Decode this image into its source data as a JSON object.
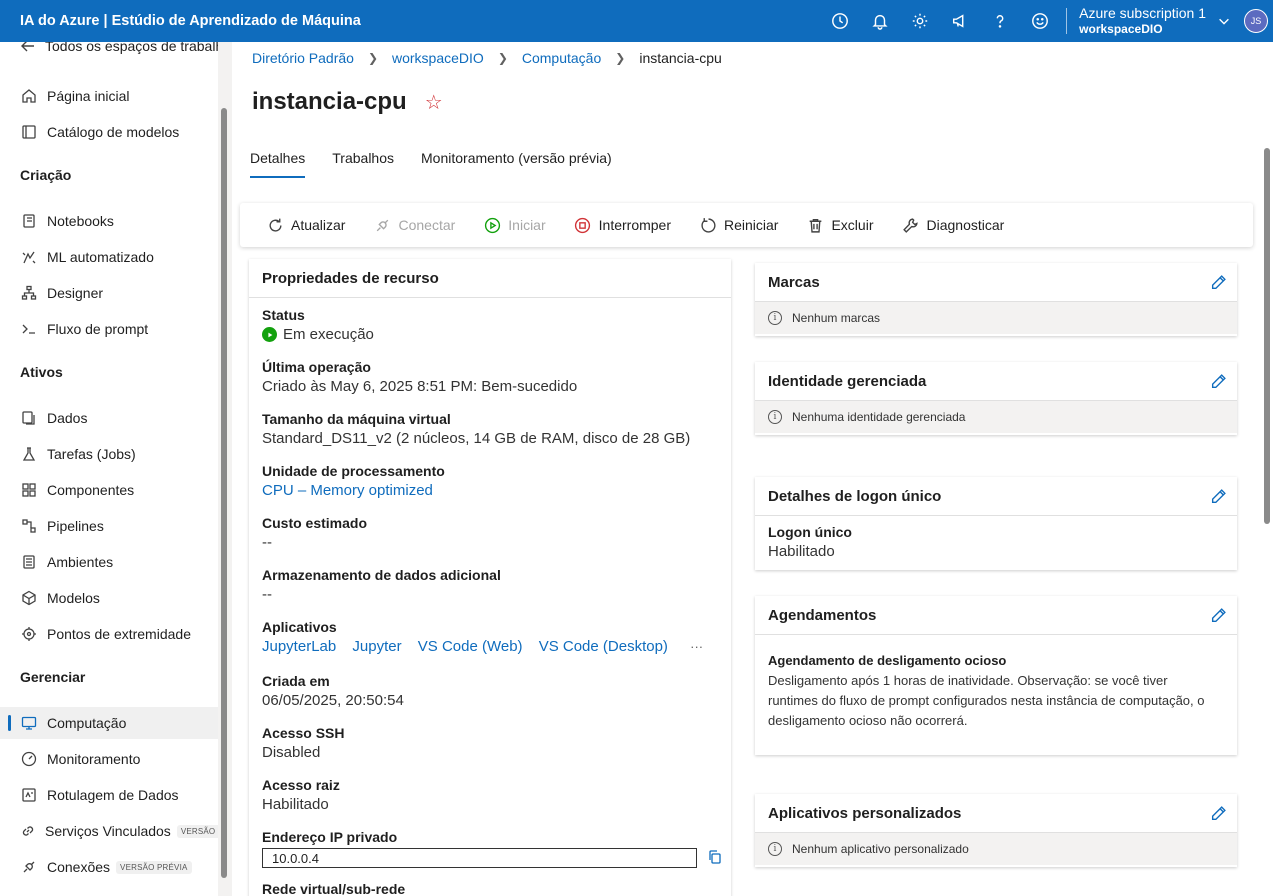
{
  "app": {
    "title": "IA do Azure | Estúdio de Aprendizado de Máquina",
    "subscription": "Azure subscription 1",
    "workspace": "workspaceDIO",
    "avatar": "JS",
    "header_icons": [
      "clock-icon",
      "bell-icon",
      "gear-icon",
      "megaphone-icon",
      "help-icon",
      "smiley-icon"
    ]
  },
  "sidebar": {
    "back_label": "Todos os espaços de trabalho",
    "items_top": [
      {
        "label": "Página inicial",
        "icon": "home-icon"
      },
      {
        "label": "Catálogo de modelos",
        "icon": "catalog-icon"
      }
    ],
    "section_criacao": "Criação",
    "items_criacao": [
      {
        "label": "Notebooks",
        "icon": "notebook-icon"
      },
      {
        "label": "ML automatizado",
        "icon": "automl-icon"
      },
      {
        "label": "Designer",
        "icon": "designer-icon"
      },
      {
        "label": "Fluxo de prompt",
        "icon": "prompt-icon"
      }
    ],
    "section_ativos": "Ativos",
    "items_ativos": [
      {
        "label": "Dados",
        "icon": "data-icon"
      },
      {
        "label": "Tarefas (Jobs)",
        "icon": "flask-icon"
      },
      {
        "label": "Componentes",
        "icon": "components-icon"
      },
      {
        "label": "Pipelines",
        "icon": "pipelines-icon"
      },
      {
        "label": "Ambientes",
        "icon": "environments-icon"
      },
      {
        "label": "Modelos",
        "icon": "cube-icon"
      },
      {
        "label": "Pontos de extremidade",
        "icon": "endpoints-icon"
      }
    ],
    "section_gerenciar": "Gerenciar",
    "items_gerenciar": [
      {
        "label": "Computação",
        "icon": "monitor-icon",
        "active": true
      },
      {
        "label": "Monitoramento",
        "icon": "gauge-icon"
      },
      {
        "label": "Rotulagem de Dados",
        "icon": "label-icon"
      },
      {
        "label": "Serviços Vinculados",
        "icon": "link-icon",
        "badge": "VERSÃO PRÉVIA"
      },
      {
        "label": "Conexões",
        "icon": "plug-icon",
        "badge": "VERSÃO PRÉVIA"
      }
    ]
  },
  "breadcrumb": [
    "Diretório Padrão",
    "workspaceDIO",
    "Computação",
    "instancia-cpu"
  ],
  "page": {
    "title": "instancia-cpu",
    "tabs": [
      "Detalhes",
      "Trabalhos",
      "Monitoramento (versão prévia)"
    ]
  },
  "toolbar": {
    "atualizar": "Atualizar",
    "conectar": "Conectar",
    "iniciar": "Iniciar",
    "interromper": "Interromper",
    "reiniciar": "Reiniciar",
    "excluir": "Excluir",
    "diagnosticar": "Diagnosticar"
  },
  "props": {
    "heading": "Propriedades de recurso",
    "status_k": "Status",
    "status_v": "Em execução",
    "ultima_k": "Última operação",
    "ultima_v": "Criado às May 6, 2025 8:51 PM: Bem-sucedido",
    "tamanho_k": "Tamanho da máquina virtual",
    "tamanho_v": "Standard_DS11_v2 (2 núcleos, 14 GB de RAM, disco de 28 GB)",
    "unidade_k": "Unidade de processamento",
    "unidade_v": "CPU – Memory optimized",
    "custo_k": "Custo estimado",
    "custo_v": "--",
    "armaz_k": "Armazenamento de dados adicional",
    "armaz_v": "--",
    "apps_k": "Aplicativos",
    "apps": [
      "JupyterLab",
      "Jupyter",
      "VS Code (Web)",
      "VS Code (Desktop)"
    ],
    "apps_more": "···",
    "criada_k": "Criada em",
    "criada_v": "06/05/2025, 20:50:54",
    "ssh_k": "Acesso SSH",
    "ssh_v": "Disabled",
    "raiz_k": "Acesso raiz",
    "raiz_v": "Habilitado",
    "ip_k": "Endereço IP privado",
    "ip_v": "10.0.0.4",
    "rede_k": "Rede virtual/sub-rede"
  },
  "marcas": {
    "heading": "Marcas",
    "note": "Nenhum marcas"
  },
  "identidade": {
    "heading": "Identidade gerenciada",
    "note": "Nenhuma identidade gerenciada"
  },
  "logon": {
    "heading": "Detalhes de logon único",
    "k": "Logon único",
    "v": "Habilitado"
  },
  "agend": {
    "heading": "Agendamentos",
    "k": "Agendamento de desligamento ocioso",
    "v": "Desligamento após 1 horas de inatividade. Observação: se você tiver runtimes do fluxo de prompt configurados nesta instância de computação, o desligamento ocioso não ocorrerá."
  },
  "custom": {
    "heading": "Aplicativos personalizados",
    "note": "Nenhum aplicativo personalizado"
  },
  "colors": {
    "accent": "#0f6cbd",
    "running": "#13a10e",
    "stop": "#d13438"
  }
}
